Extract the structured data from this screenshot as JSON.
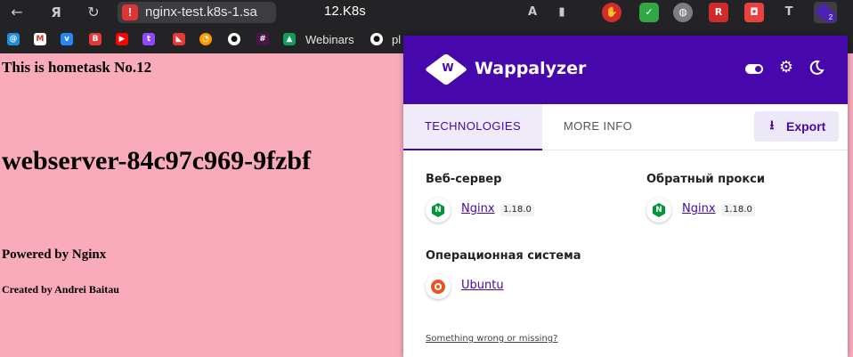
{
  "browser": {
    "url": "nginx-test.k8s-1.sa",
    "tab_title": "12.K8s",
    "wappalyzer_badge": "2"
  },
  "bookmarks": {
    "webinars_label": "Webinars",
    "truncated_label": "pl"
  },
  "page": {
    "heading_task": "This is hometask No.12",
    "heading_host": "webserver-84c97c969-9fzbf",
    "powered_by": "Powered by Nginx",
    "created_by": "Created by Andrei Baitau"
  },
  "wappalyzer": {
    "brand": "Wappalyzer",
    "tabs": {
      "technologies": "TECHNOLOGIES",
      "more_info": "MORE INFO"
    },
    "export_label": "Export",
    "categories": [
      {
        "name": "Веб-сервер",
        "items": [
          {
            "name": "Nginx",
            "version": "1.18.0",
            "icon": "nginx-icon"
          }
        ]
      },
      {
        "name": "Обратный прокси",
        "items": [
          {
            "name": "Nginx",
            "version": "1.18.0",
            "icon": "nginx-icon"
          }
        ]
      },
      {
        "name": "Операционная система",
        "items": [
          {
            "name": "Ubuntu",
            "version": "",
            "icon": "ubuntu-icon"
          }
        ]
      }
    ],
    "footer_link": "Something wrong or missing?"
  },
  "colors": {
    "page_background": "#f9abbc",
    "wappalyzer_purple": "#4608ad",
    "browser_chrome": "#232326",
    "nginx_green": "#009639",
    "ubuntu_orange": "#e95420"
  }
}
